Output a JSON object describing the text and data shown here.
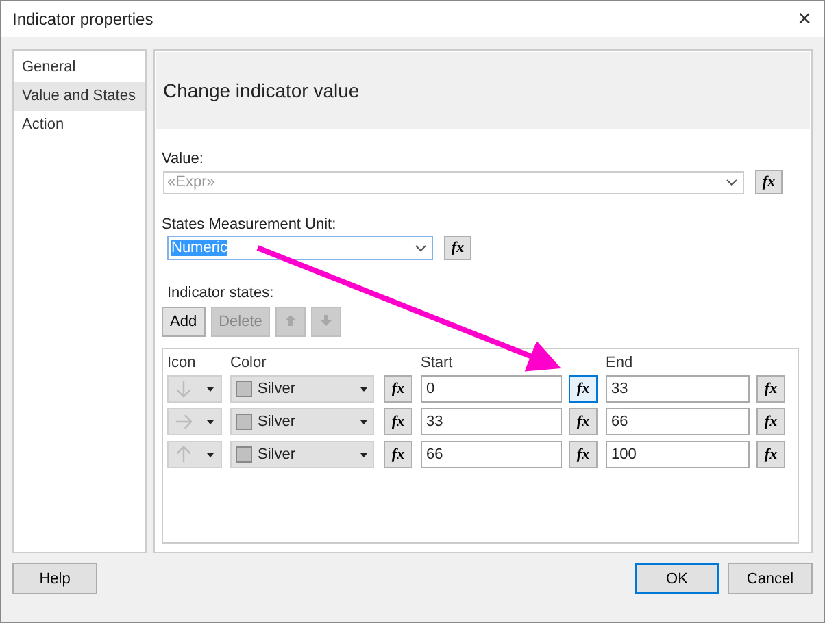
{
  "window": {
    "title": "Indicator properties",
    "close": "×"
  },
  "sidebar": {
    "items": [
      {
        "label": "General",
        "selected": false
      },
      {
        "label": "Value and States",
        "selected": true
      },
      {
        "label": "Action",
        "selected": false
      }
    ]
  },
  "page_title": "Change indicator value",
  "value": {
    "label": "Value:",
    "placeholder": "«Expr»",
    "fx": "fx"
  },
  "unit": {
    "label": "States Measurement Unit:",
    "value": "Numeric",
    "text_selected": true,
    "fx": "fx"
  },
  "states_label": "Indicator states:",
  "toolbar": [
    {
      "kind": "text",
      "label": "Add",
      "disabled": false
    },
    {
      "kind": "text",
      "label": "Delete",
      "disabled": true
    },
    {
      "kind": "up",
      "disabled": true
    },
    {
      "kind": "down",
      "disabled": true
    }
  ],
  "table": {
    "columns": [
      "Icon",
      "Color",
      "Start",
      "End"
    ],
    "rows": [
      {
        "kind": "down",
        "color": "#c0c0c0",
        "color_name": "Silver",
        "color_fx": "fx",
        "start": "0",
        "start_fx": "fx",
        "start_fx_focused": true,
        "end": "33",
        "end_fx": "fx"
      },
      {
        "kind": "right",
        "color": "#c0c0c0",
        "color_name": "Silver",
        "color_fx": "fx",
        "start": "33",
        "start_fx": "fx",
        "start_fx_focused": false,
        "end": "66",
        "end_fx": "fx"
      },
      {
        "kind": "up",
        "color": "#c0c0c0",
        "color_name": "Silver",
        "color_fx": "fx",
        "start": "66",
        "start_fx": "fx",
        "start_fx_focused": false,
        "end": "100",
        "end_fx": "fx"
      }
    ]
  },
  "buttons": [
    {
      "label": "Help",
      "default": false
    },
    {
      "label": "OK",
      "default": true
    },
    {
      "label": "Cancel",
      "default": false
    }
  ]
}
